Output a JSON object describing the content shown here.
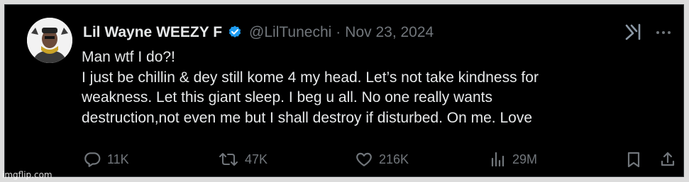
{
  "tweet": {
    "author_name": "Lil Wayne WEEZY F",
    "handle": "@LilTunechi",
    "separator": "·",
    "date": "Nov 23, 2024",
    "lines": [
      "Man wtf I do?!",
      "I just be chillin & dey still kome 4 my head. Let’s not take kindness for",
      "weakness. Let this giant sleep. I beg u all.  No one really wants",
      "destruction,not even me but I shall destroy if disturbed. On me. Love"
    ]
  },
  "actions": {
    "replies": "11K",
    "reposts": "47K",
    "likes": "216K",
    "views": "29M"
  },
  "icons": {
    "verified": "verified-badge-icon",
    "grok": "grok-icon",
    "more": "more-icon",
    "reply": "reply-icon",
    "repost": "repost-icon",
    "like": "heart-icon",
    "views": "views-icon",
    "bookmark": "bookmark-icon",
    "share": "share-icon"
  },
  "colors": {
    "background": "#000000",
    "text": "#e7e9ea",
    "muted": "#71767b",
    "verified": "#1d9bf0"
  },
  "watermark": "imgflip.com"
}
